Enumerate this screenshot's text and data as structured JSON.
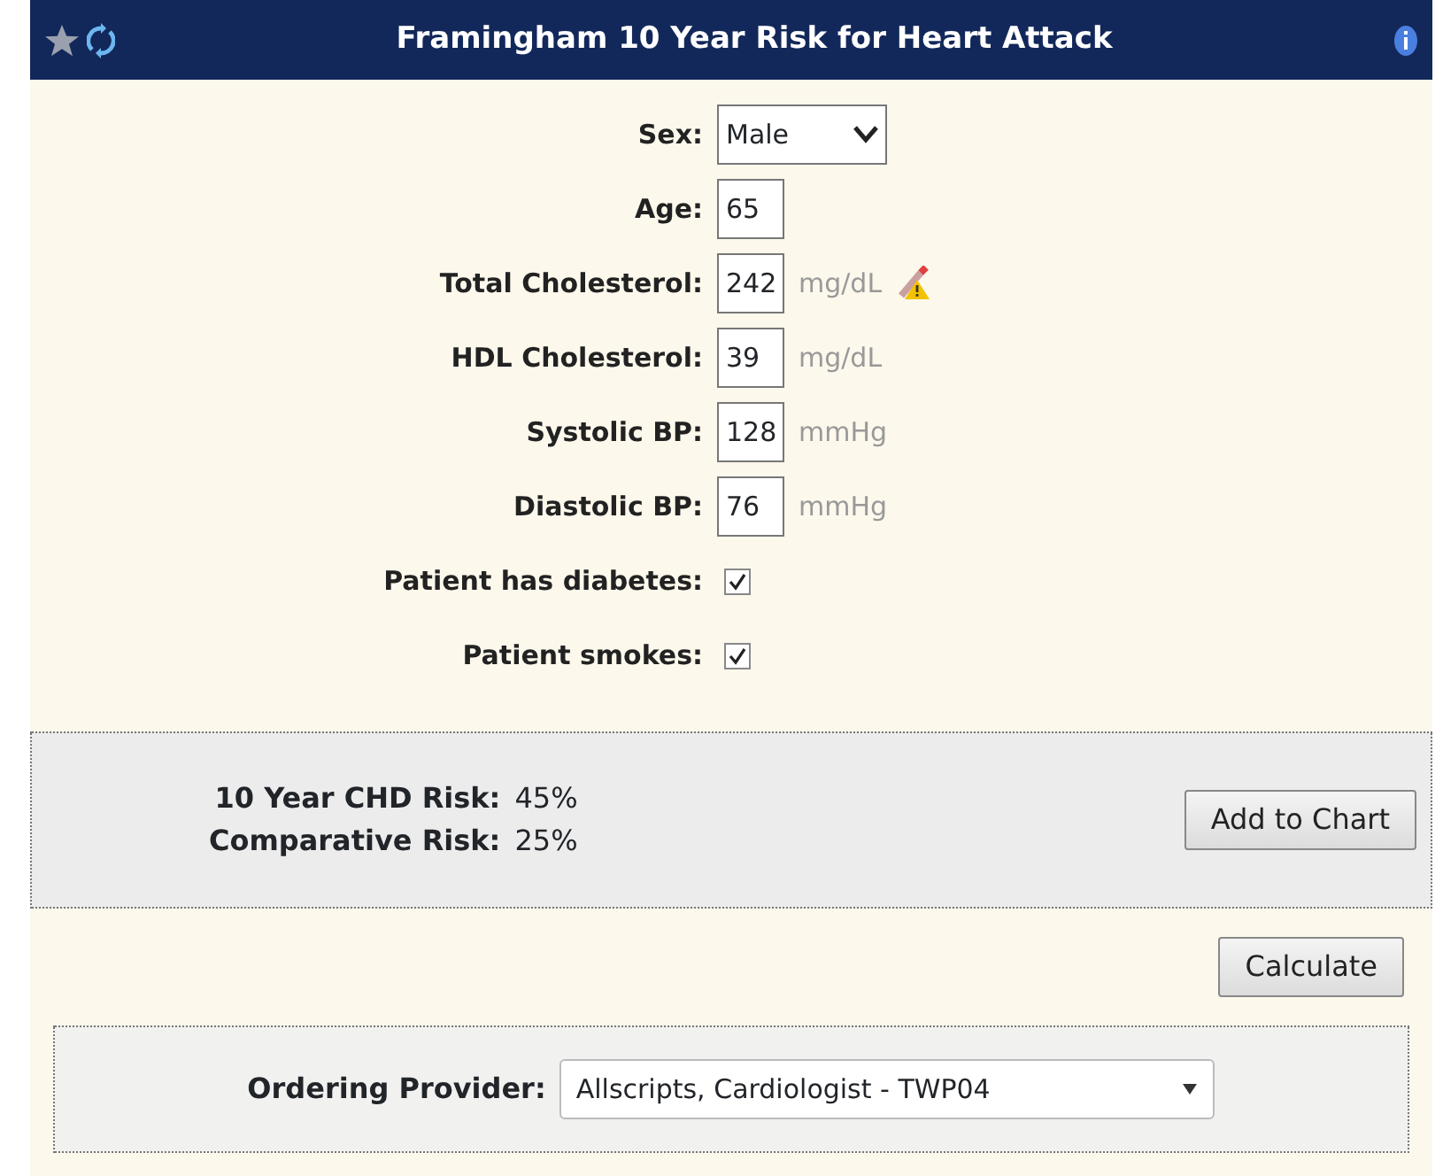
{
  "header": {
    "title": "Framingham 10 Year Risk for Heart Attack"
  },
  "fields": [
    {
      "kind": "select",
      "label": "Sex:",
      "value": "Male"
    },
    {
      "kind": "number",
      "label": "Age:",
      "value": "65"
    },
    {
      "kind": "number",
      "label": "Total Cholesterol:",
      "value": "242",
      "unit": "mg/dL",
      "warning": true
    },
    {
      "kind": "number",
      "label": "HDL Cholesterol:",
      "value": "39",
      "unit": "mg/dL"
    },
    {
      "kind": "number",
      "label": "Systolic BP:",
      "value": "128",
      "unit": "mmHg"
    },
    {
      "kind": "number",
      "label": "Diastolic BP:",
      "value": "76",
      "unit": "mmHg"
    },
    {
      "kind": "checkbox",
      "label": "Patient has diabetes:",
      "checked": true
    },
    {
      "kind": "checkbox",
      "label": "Patient smokes:",
      "checked": true
    }
  ],
  "results": [
    {
      "label": "10 Year CHD Risk:",
      "value": "45%"
    },
    {
      "label": "Comparative Risk:",
      "value": "25%"
    }
  ],
  "add_button": "Add to Chart",
  "calculate_button": "Calculate",
  "provider": {
    "label": "Ordering Provider:",
    "value": "Allscripts, Cardiologist - TWP04"
  }
}
